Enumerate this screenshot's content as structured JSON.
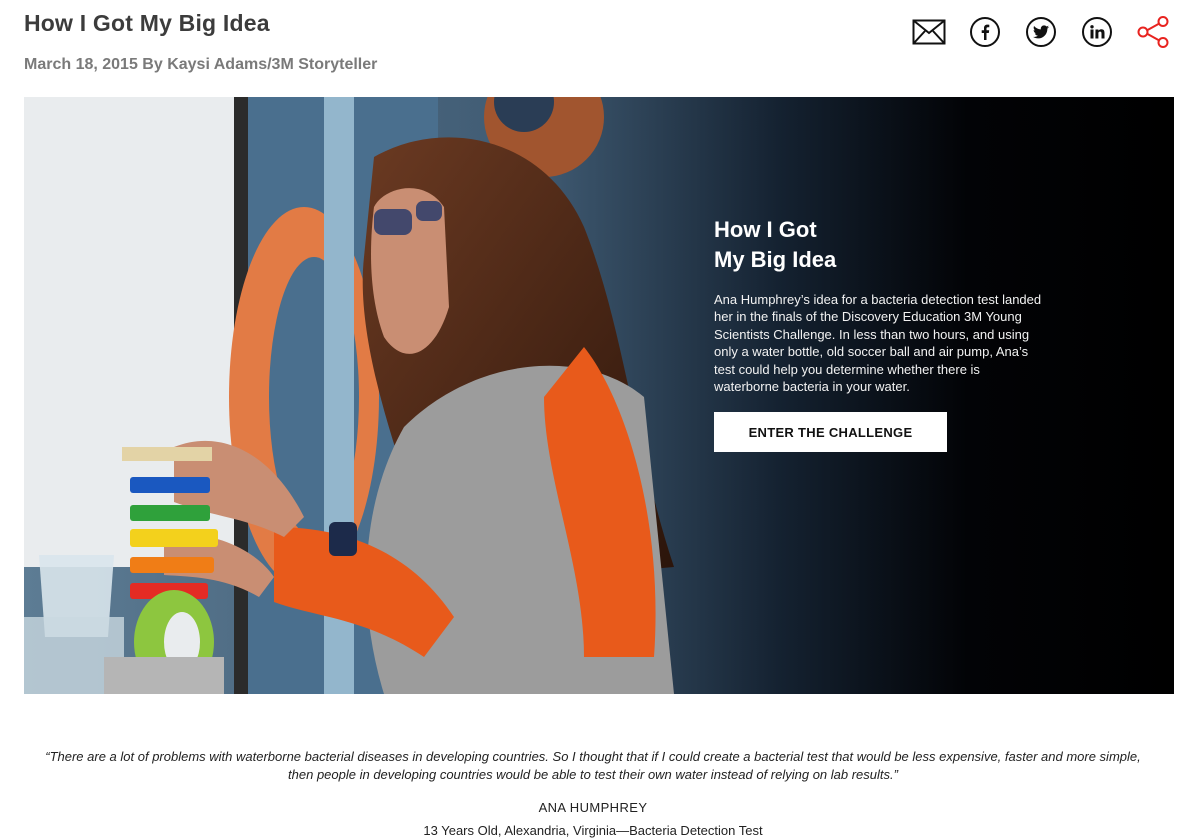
{
  "article": {
    "title": "How I Got My Big Idea",
    "meta": "March 18, 2015 By Kaysi Adams/3M Storyteller"
  },
  "share": {
    "icons": [
      "mail-icon",
      "facebook-icon",
      "twitter-icon",
      "linkedin-icon",
      "share-icon"
    ],
    "share_icon_color": "#e8231f"
  },
  "hero": {
    "heading_line1": "How I Got",
    "heading_line2": "My Big Idea",
    "body": "Ana Humphrey’s idea for a bacteria detection test landed her in the finals of the Discovery Education 3M Young Scientists Challenge. In less than two hours, and using only a water bottle, old soccer ball and air pump, Ana’s test could help you determine whether there is waterborne bacteria in your water.",
    "cta_label": "ENTER THE CHALLENGE"
  },
  "quote": {
    "text": "“There are a lot of problems with waterborne bacterial diseases in developing countries. So I thought that if I could create a bacterial test that would be less expensive, faster and more simple, then people in developing countries would be able to test their own water instead of relying on lab results.”",
    "name": "ANA HUMPHREY",
    "detail": "13 Years Old, Alexandria, Virginia—Bacteria Detection Test"
  }
}
